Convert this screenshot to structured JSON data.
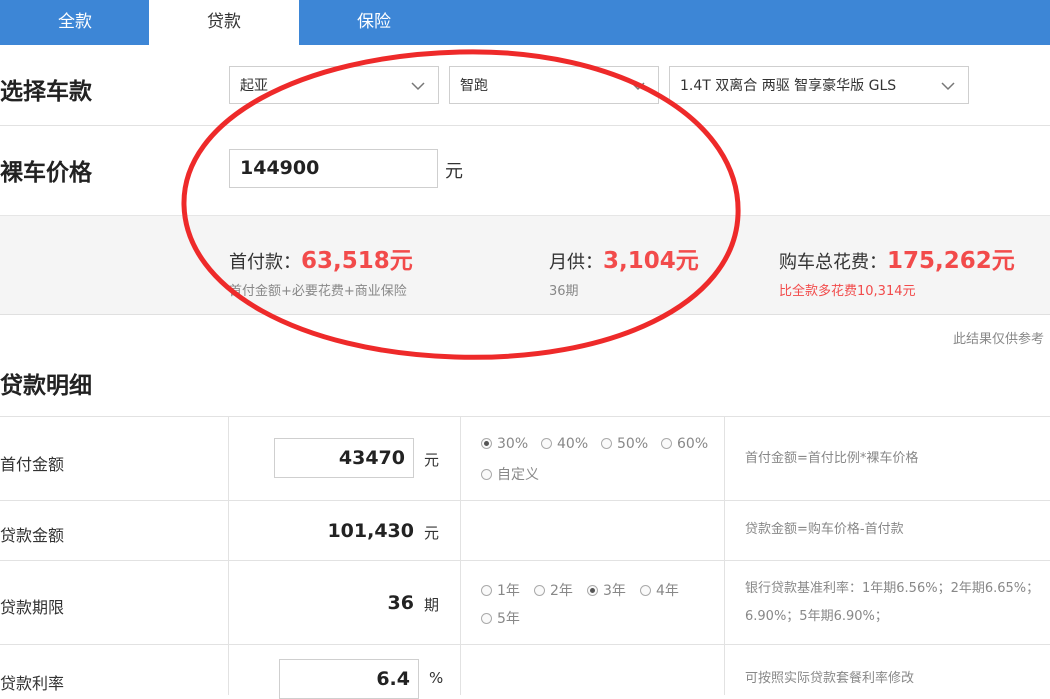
{
  "tabs": [
    {
      "label": "全款",
      "active": false
    },
    {
      "label": "贷款",
      "active": true
    },
    {
      "label": "保险",
      "active": false
    }
  ],
  "car_select": {
    "label": "选择车款",
    "brand": "起亚",
    "model": "智跑",
    "trim": "1.4T 双离合 两驱 智享豪华版 GLS"
  },
  "price": {
    "label": "裸车价格",
    "value": "144900",
    "unit": "元"
  },
  "summary": {
    "down_payment_label": "首付款：",
    "down_payment_value": "63,518元",
    "down_payment_note": "首付金额+必要花费+商业保险",
    "monthly_label": "月供：",
    "monthly_value": "3,104元",
    "monthly_note": "36期",
    "total_label": "购车总花费：",
    "total_value": "175,262元",
    "total_note": "比全款多花费10,314元"
  },
  "disclaimer": "此结果仅供参考",
  "loan_detail": {
    "title": "贷款明细",
    "rows": [
      {
        "label": "首付金额",
        "value": "43470",
        "unit": "元",
        "options": [
          "30%",
          "40%",
          "50%",
          "60%",
          "自定义"
        ],
        "selected": "30%",
        "formula": "首付金额=首付比例*裸车价格"
      },
      {
        "label": "贷款金额",
        "value": "101,430",
        "unit": "元",
        "formula": "贷款金额=购车价格-首付款"
      },
      {
        "label": "贷款期限",
        "value": "36",
        "unit": "期",
        "options": [
          "1年",
          "2年",
          "3年",
          "4年",
          "5年"
        ],
        "selected": "3年",
        "formula_line1": "银行贷款基准利率：1年期6.56%；2年期6.65%；",
        "formula_line2": "6.90%；5年期6.90%；"
      },
      {
        "label": "贷款利率",
        "value": "6.4",
        "unit": "%",
        "formula": "可按照实际贷款套餐利率修改"
      }
    ]
  },
  "colors": {
    "tab_bar": "#3d86d6",
    "highlight_red": "#f24b4b",
    "annotation_circle": "#ee2a2a"
  }
}
